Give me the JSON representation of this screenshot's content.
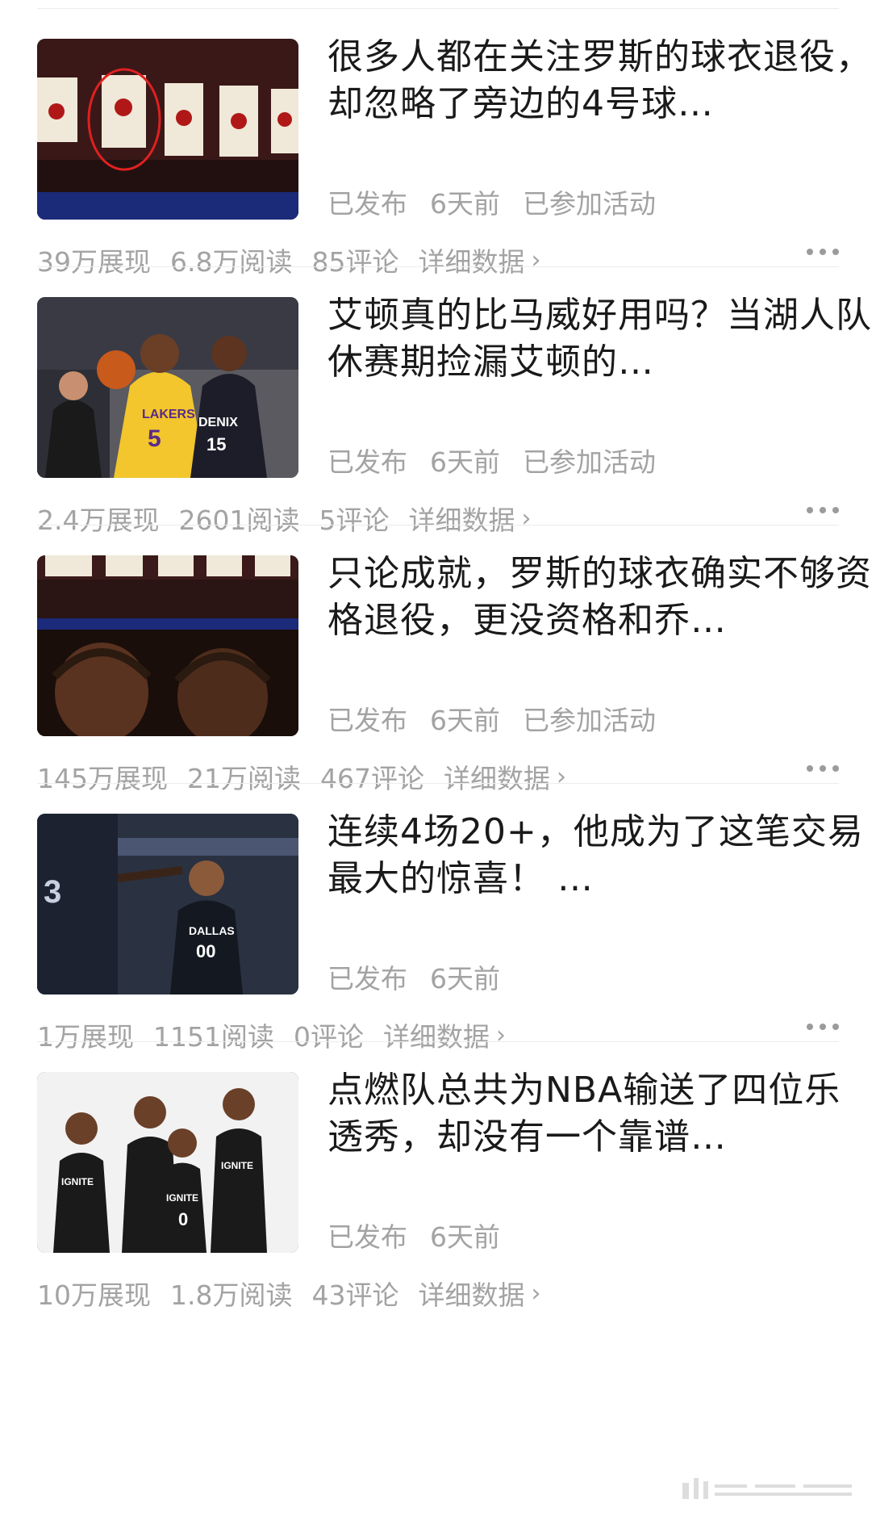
{
  "articles": [
    {
      "title": "很多人都在关注罗斯的球衣退役，却忽略了旁边的4号球…",
      "meta": [
        "已发布",
        "6天前",
        "已参加活动"
      ],
      "stats": [
        "39万展现",
        "6.8万阅读",
        "85评论"
      ],
      "detail_label": "详细数据",
      "thumb": "jersey-banners-image"
    },
    {
      "title": "艾顿真的比马威好用吗？当湖人队休赛期捡漏艾顿的…",
      "meta": [
        "已发布",
        "6天前",
        "已参加活动"
      ],
      "stats": [
        "2.4万展现",
        "2601阅读",
        "5评论"
      ],
      "detail_label": "详细数据",
      "thumb": "lakers-basketball-image"
    },
    {
      "title": "只论成就，罗斯的球衣确实不够资格退役，更没资格和乔…",
      "meta": [
        "已发布",
        "6天前",
        "已参加活动"
      ],
      "stats": [
        "145万展现",
        "21万阅读",
        "467评论"
      ],
      "detail_label": "详细数据",
      "thumb": "rose-tears-image"
    },
    {
      "title": "连续4场20+，他成为了这笔交易最大的惊喜！ …",
      "meta": [
        "已发布",
        "6天前"
      ],
      "stats": [
        "1万展现",
        "1151阅读",
        "0评论"
      ],
      "detail_label": "详细数据",
      "thumb": "dallas-player-image"
    },
    {
      "title": "点燃队总共为NBA输送了四位乐透秀，却没有一个靠谱…",
      "meta": [
        "已发布",
        "6天前"
      ],
      "stats": [
        "10万展现",
        "1.8万阅读",
        "43评论"
      ],
      "detail_label": "详细数据",
      "thumb": "ignite-team-image"
    }
  ],
  "colors": {
    "title": "#1a1a1a",
    "meta": "#a3a3a3",
    "divider": "#ececec"
  }
}
